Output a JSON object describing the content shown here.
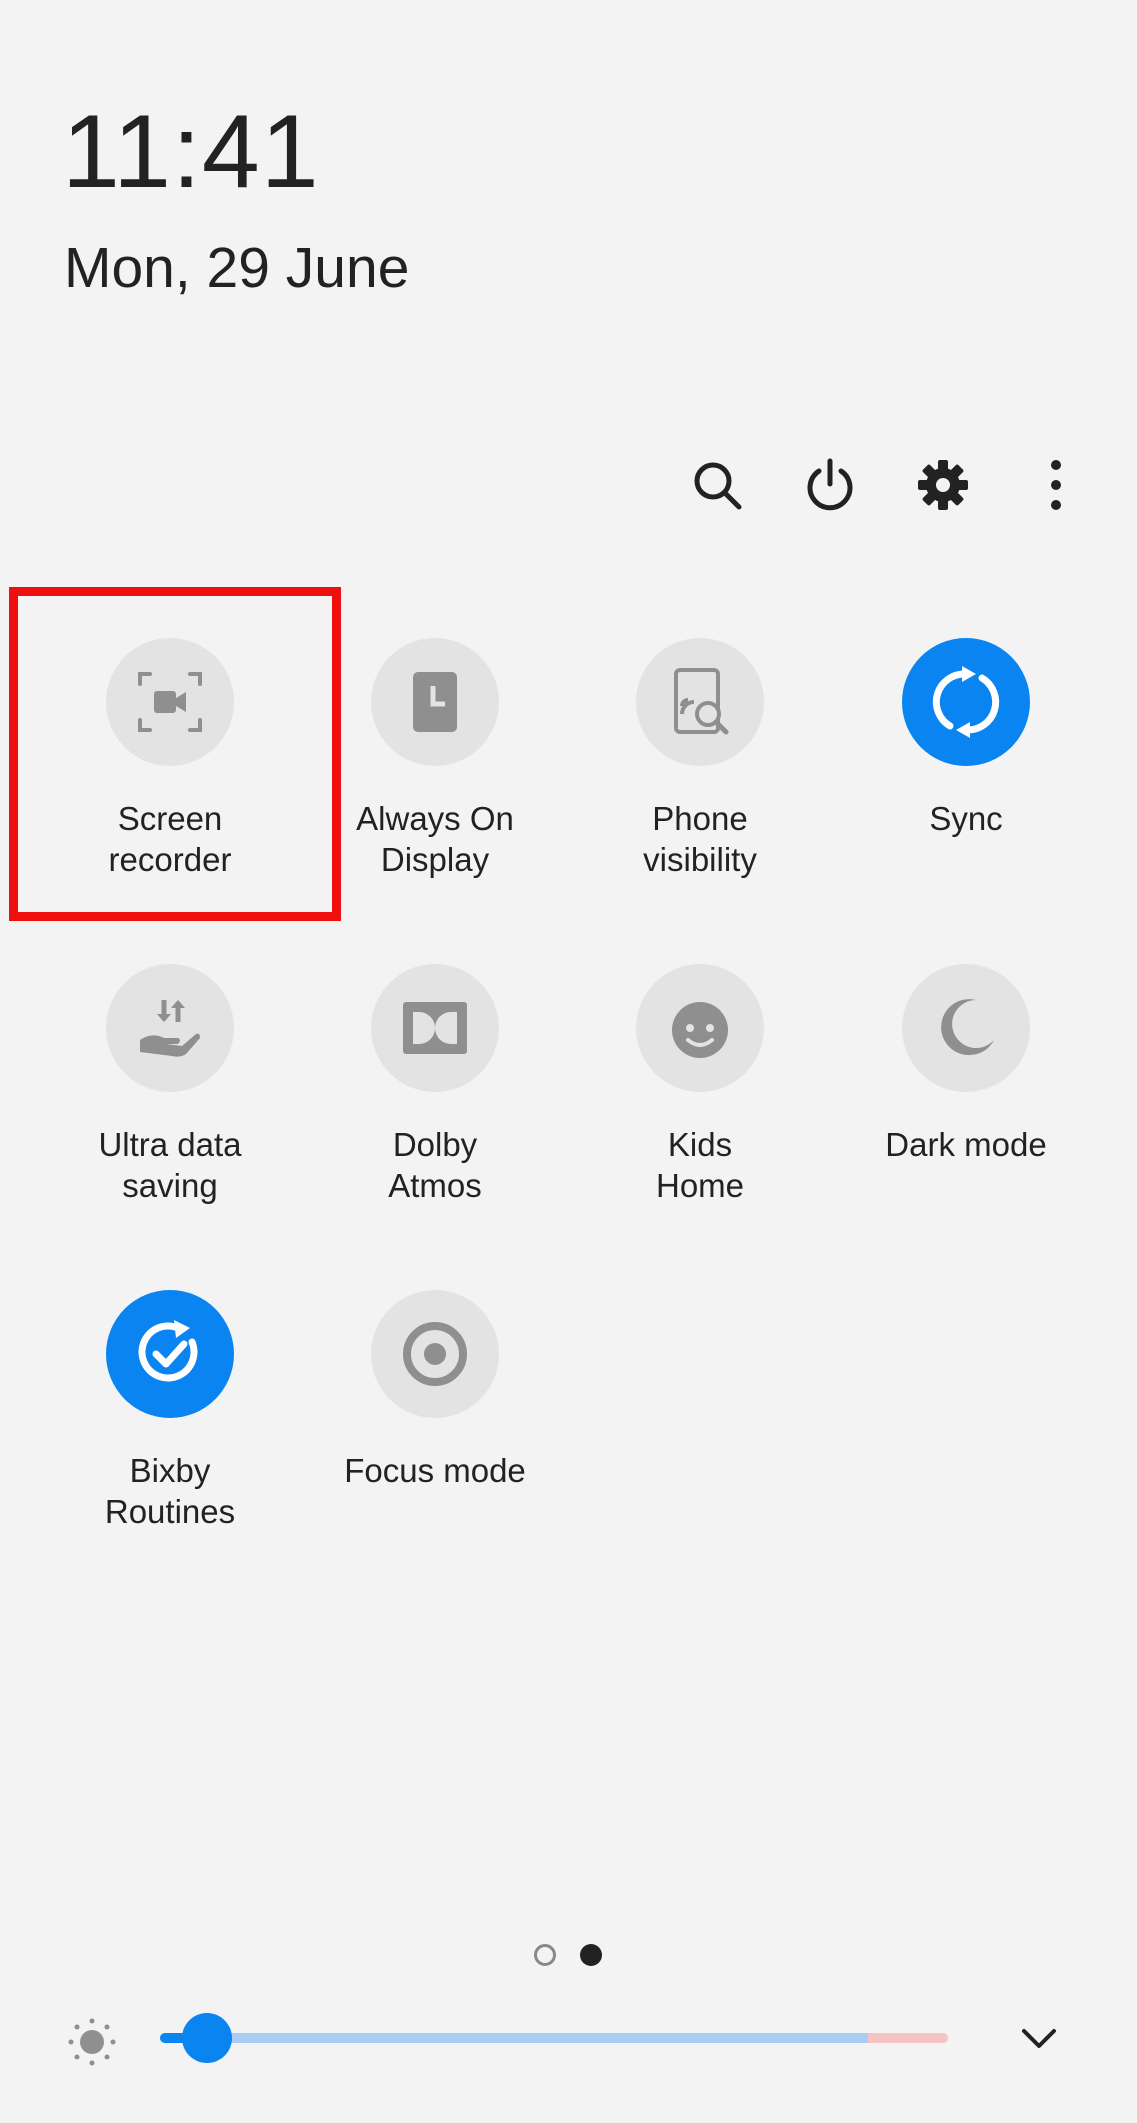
{
  "status": {
    "time": "11:41",
    "date": "Mon, 29 June"
  },
  "top_actions": [
    {
      "name": "search",
      "icon": "search-icon"
    },
    {
      "name": "power",
      "icon": "power-icon"
    },
    {
      "name": "settings",
      "icon": "gear-icon"
    },
    {
      "name": "more",
      "icon": "more-vertical-icon"
    }
  ],
  "tiles": [
    {
      "line1": "Screen",
      "line2": "recorder",
      "icon": "screen-recorder-icon",
      "active": false,
      "highlighted": true
    },
    {
      "line1": "Always On",
      "line2": "Display",
      "icon": "always-on-display-icon",
      "active": false
    },
    {
      "line1": "Phone",
      "line2": "visibility",
      "icon": "phone-visibility-icon",
      "active": false
    },
    {
      "line1": "Sync",
      "line2": "",
      "icon": "sync-icon",
      "active": true
    },
    {
      "line1": "Ultra data",
      "line2": "saving",
      "icon": "data-saving-icon",
      "active": false
    },
    {
      "line1": "Dolby",
      "line2": "Atmos",
      "icon": "dolby-icon",
      "active": false
    },
    {
      "line1": "Kids",
      "line2": "Home",
      "icon": "kids-home-icon",
      "active": false
    },
    {
      "line1": "Dark mode",
      "line2": "",
      "icon": "moon-icon",
      "active": false
    },
    {
      "line1": "Bixby",
      "line2": "Routines",
      "icon": "bixby-routines-icon",
      "active": true
    },
    {
      "line1": "Focus mode",
      "line2": "",
      "icon": "focus-mode-icon",
      "active": false
    }
  ],
  "pagination": {
    "pages": 2,
    "current_page": 2
  },
  "brightness": {
    "level": 0.06
  },
  "colors": {
    "accent": "#0a84f0",
    "tile_off": "#e3e3e3",
    "highlight": "#ee0f0f",
    "background": "#f3f3f3"
  }
}
